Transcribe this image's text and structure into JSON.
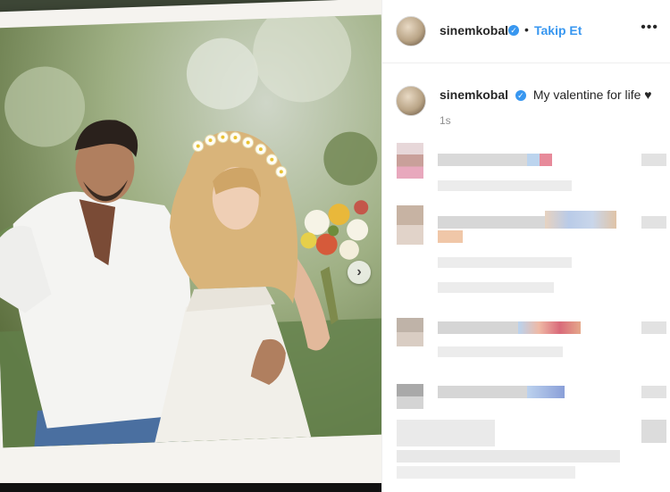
{
  "post": {
    "username": "sinemkobal",
    "follow_separator": "•",
    "follow_label": "Takip Et",
    "more_icon": "more-horizontal-icon",
    "verified_icon": "verified-badge-icon",
    "caption_text": "My valentine for life ♥",
    "time_ago": "1s"
  },
  "colors": {
    "accent": "#3897f0",
    "text": "#262626",
    "muted": "#8e8e8e"
  },
  "carousel": {
    "next_icon": "chevron-right-icon",
    "next_glyph": "›"
  }
}
